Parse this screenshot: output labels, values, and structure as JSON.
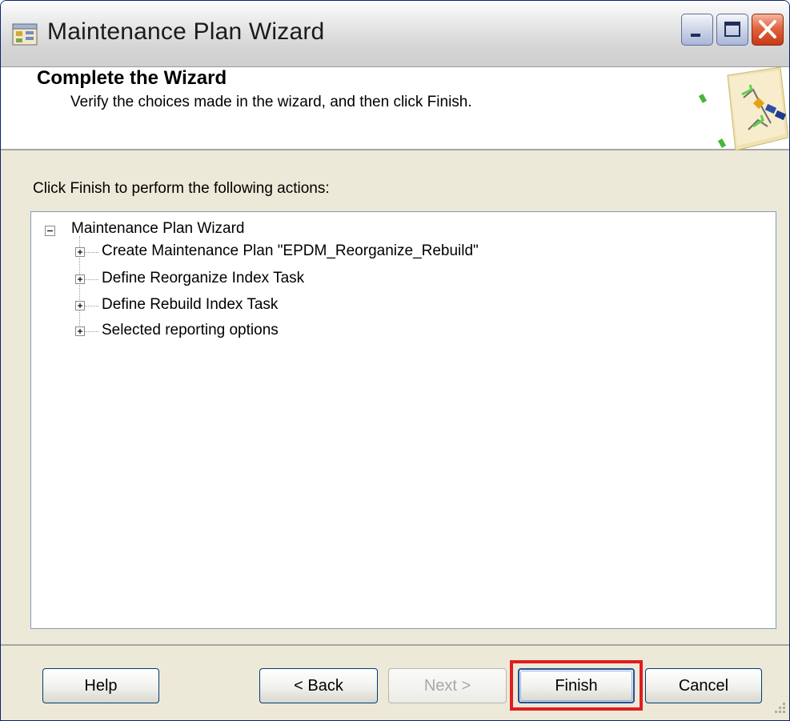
{
  "window": {
    "title": "Maintenance Plan Wizard",
    "controls": [
      "minimize",
      "maximize",
      "close"
    ]
  },
  "header": {
    "title": "Complete the Wizard",
    "subtitle": "Verify the choices made in the wizard, and then click Finish."
  },
  "main": {
    "instructions": "Click Finish to perform the following actions:",
    "tree": {
      "root": {
        "label": "Maintenance Plan Wizard",
        "expanded": true
      },
      "items": [
        {
          "label": "Create Maintenance Plan \"EPDM_Reorganize_Rebuild\"",
          "expanded": false
        },
        {
          "label": "Define Reorganize Index Task",
          "expanded": false
        },
        {
          "label": "Define Rebuild Index Task",
          "expanded": false
        },
        {
          "label": "Selected reporting options",
          "expanded": false
        }
      ]
    }
  },
  "footer": {
    "help": "Help",
    "back": "< Back",
    "next": "Next >",
    "finish": "Finish",
    "cancel": "Cancel"
  },
  "colors": {
    "highlight": "#e21d1d",
    "button_border": "#003c74",
    "close_button": "#d2441f"
  }
}
